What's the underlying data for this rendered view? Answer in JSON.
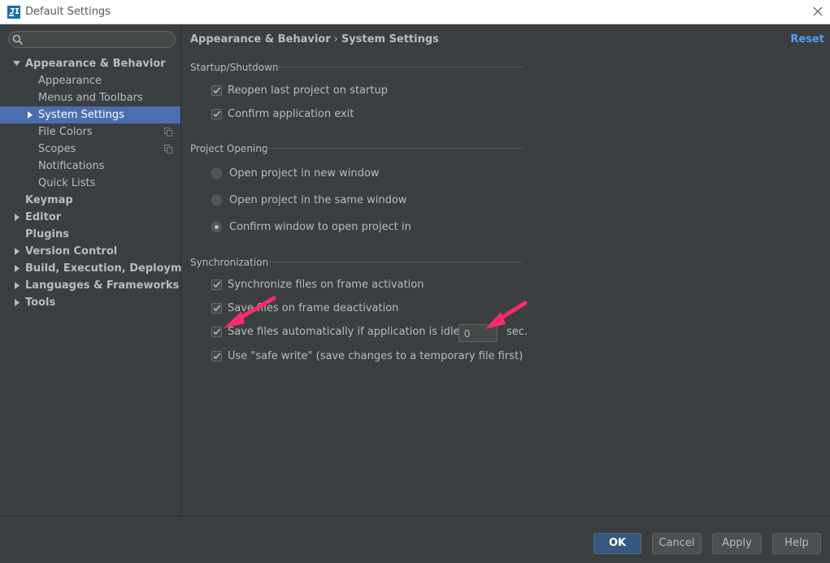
{
  "window": {
    "title": "Default Settings"
  },
  "search": {
    "value": "",
    "placeholder": ""
  },
  "tree": {
    "appearance_behavior": "Appearance & Behavior",
    "appearance": "Appearance",
    "menus_toolbars": "Menus and Toolbars",
    "system_settings": "System Settings",
    "file_colors": "File Colors",
    "scopes": "Scopes",
    "notifications": "Notifications",
    "quick_lists": "Quick Lists",
    "keymap": "Keymap",
    "editor": "Editor",
    "plugins": "Plugins",
    "version_control": "Version Control",
    "build": "Build, Execution, Deployment",
    "languages": "Languages & Frameworks",
    "tools": "Tools"
  },
  "breadcrumb": {
    "parent": "Appearance & Behavior",
    "separator": "›",
    "current": "System Settings"
  },
  "reset_label": "Reset",
  "startup": {
    "title": "Startup/Shutdown",
    "reopen": {
      "label": "Reopen last project on startup",
      "checked": true
    },
    "confirm_exit": {
      "label": "Confirm application exit",
      "checked": true
    }
  },
  "project_opening": {
    "title": "Project Opening",
    "new_window": "Open project in new window",
    "same_window": "Open project in the same window",
    "confirm_window": "Confirm window to open project in",
    "selected": "confirm_window"
  },
  "sync": {
    "title": "Synchronization",
    "frame_activation": {
      "label": "Synchronize files on frame activation",
      "checked": true
    },
    "frame_deactivation": {
      "label": "Save files on frame deactivation",
      "checked": true
    },
    "idle_save": {
      "label": "Save files automatically if application is idle for",
      "checked": true,
      "value": "0",
      "unit": "sec."
    },
    "safe_write": {
      "label": "Use \"safe write\" (save changes to a temporary file first)",
      "checked": true
    }
  },
  "buttons": {
    "ok": "OK",
    "cancel": "Cancel",
    "apply": "Apply",
    "help": "Help"
  },
  "colors": {
    "accent": "#4b6eaf",
    "link": "#589df6",
    "annotation_arrow": "#ff2a6e"
  }
}
